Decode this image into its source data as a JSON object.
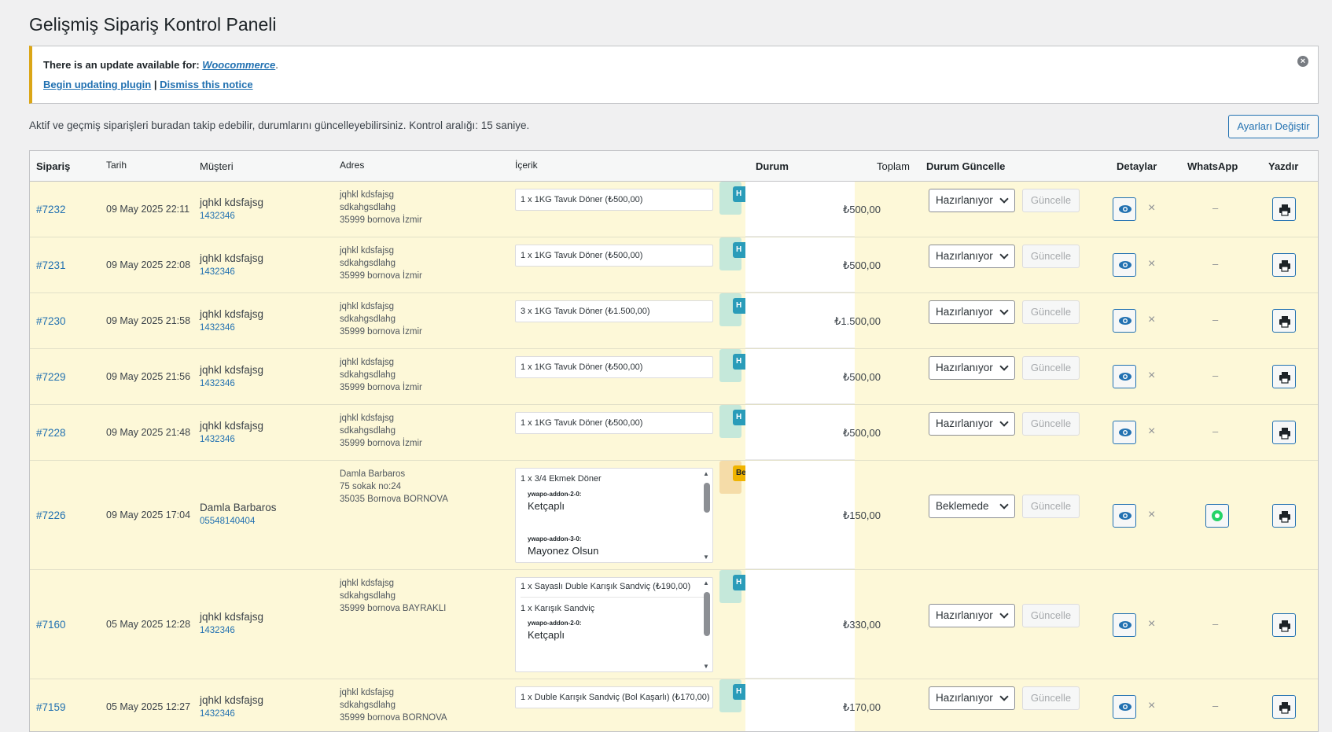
{
  "page_title": "Gelişmiş Sipariş Kontrol Paneli",
  "notice": {
    "text": "There is an update available for: ",
    "plugin": "Woocommerce",
    "period": ".",
    "begin_label": "Begin updating plugin",
    "separator": "|",
    "dismiss_label": "Dismiss this notice",
    "close_glyph": "×"
  },
  "intro": "Aktif ve geçmiş siparişleri buradan takip edebilir, durumlarını güncelleyebilirsiniz. Kontrol aralığı: 15 saniye.",
  "settings_button": "Ayarları Değiştir",
  "columns": {
    "order": "Sipariş",
    "date": "Tarih",
    "customer": "Müşteri",
    "address": "Adres",
    "content": "İçerik",
    "status": "Durum",
    "total": "Toplam",
    "status_update": "Durum Güncelle",
    "details": "Detaylar",
    "whatsapp": "WhatsApp",
    "print": "Yazdır"
  },
  "update_label": "Güncelle",
  "close_glyph": "×",
  "dash": "–",
  "rows": [
    {
      "order": "#7232",
      "date": "09 May 2025 22:11",
      "name": "jqhkl kdsfajsg",
      "phone": "1432346",
      "addr": [
        "jqhkl kdsfajsg",
        "sdkahgsdlahg",
        "35999 bornova İzmir"
      ],
      "item": "1 x 1KG Tavuk Döner (₺500,00)",
      "status_badge": "H",
      "total": "₺500,00",
      "status_select": "Hazırlanıyor"
    },
    {
      "order": "#7231",
      "date": "09 May 2025 22:08",
      "name": "jqhkl kdsfajsg",
      "phone": "1432346",
      "addr": [
        "jqhkl kdsfajsg",
        "sdkahgsdlahg",
        "35999 bornova İzmir"
      ],
      "item": "1 x 1KG Tavuk Döner (₺500,00)",
      "status_badge": "H",
      "total": "₺500,00",
      "status_select": "Hazırlanıyor"
    },
    {
      "order": "#7230",
      "date": "09 May 2025 21:58",
      "name": "jqhkl kdsfajsg",
      "phone": "1432346",
      "addr": [
        "jqhkl kdsfajsg",
        "sdkahgsdlahg",
        "35999 bornova İzmir"
      ],
      "item": "3 x 1KG Tavuk Döner (₺1.500,00)",
      "status_badge": "H",
      "total": "₺1.500,00",
      "status_select": "Hazırlanıyor"
    },
    {
      "order": "#7229",
      "date": "09 May 2025 21:56",
      "name": "jqhkl kdsfajsg",
      "phone": "1432346",
      "addr": [
        "jqhkl kdsfajsg",
        "sdkahgsdlahg",
        "35999 bornova İzmir"
      ],
      "item": "1 x 1KG Tavuk Döner (₺500,00)",
      "status_badge": "H",
      "total": "₺500,00",
      "status_select": "Hazırlanıyor"
    },
    {
      "order": "#7228",
      "date": "09 May 2025 21:48",
      "name": "jqhkl kdsfajsg",
      "phone": "1432346",
      "addr": [
        "jqhkl kdsfajsg",
        "sdkahgsdlahg",
        "35999 bornova İzmir"
      ],
      "item": "1 x 1KG Tavuk Döner (₺500,00)",
      "status_badge": "H",
      "total": "₺500,00",
      "status_select": "Hazırlanıyor"
    },
    {
      "order": "#7226",
      "date": "09 May 2025 17:04",
      "name": "Damla Barbaros",
      "phone": "05548140404",
      "addr": [
        "Damla Barbaros",
        "75 sokak no:24",
        "35035 Bornova BORNOVA"
      ],
      "item": "1 x 3/4 Ekmek Döner",
      "addons": [
        {
          "label": "ywapo-addon-2-0:",
          "value": "Ketçaplı"
        },
        {
          "label": "ywapo-addon-3-0:",
          "value": "Mayonez Olsun"
        }
      ],
      "status_badge": "Be",
      "total": "₺150,00",
      "status_select": "Beklemede"
    },
    {
      "order": "#7160",
      "date": "05 May 2025 12:28",
      "name": "jqhkl kdsfajsg",
      "phone": "1432346",
      "addr": [
        "jqhkl kdsfajsg",
        "sdkahgsdlahg",
        "35999 bornova BAYRAKLI"
      ],
      "item": "1 x Sayaslı Duble Karışık Sandviç (₺190,00)",
      "item2": "1 x Karışık Sandviç",
      "addons": [
        {
          "label": "ywapo-addon-2-0:",
          "value": "Ketçaplı"
        }
      ],
      "status_badge": "H",
      "total": "₺330,00",
      "status_select": "Hazırlanıyor"
    },
    {
      "order": "#7159",
      "date": "05 May 2025 12:27",
      "name": "jqhkl kdsfajsg",
      "phone": "1432346",
      "addr": [
        "jqhkl kdsfajsg",
        "sdkahgsdlahg",
        "35999 bornova BORNOVA"
      ],
      "item": "1 x Duble Karışık Sandviç (Bol Kaşarlı) (₺170,00)",
      "status_badge": "H",
      "total": "₺170,00",
      "status_select": "Hazırlanıyor"
    }
  ]
}
